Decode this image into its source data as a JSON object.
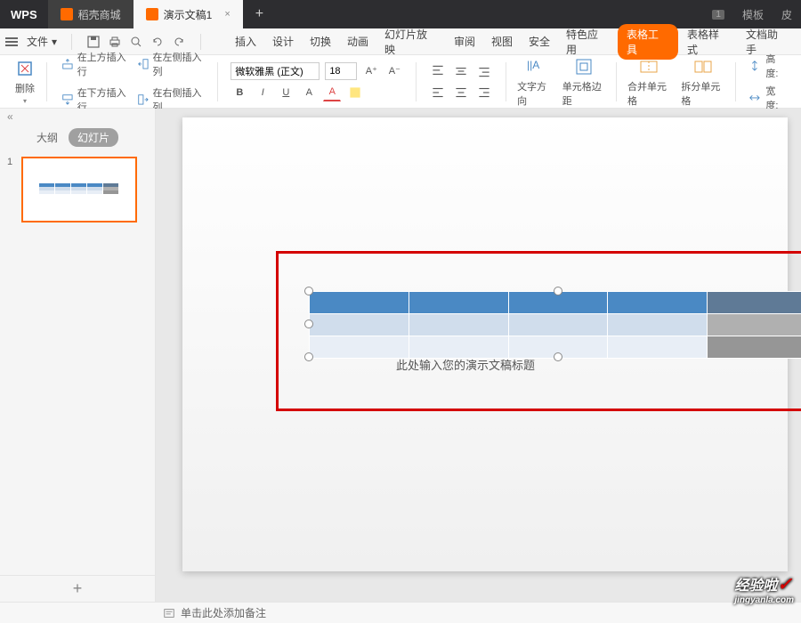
{
  "titlebar": {
    "logo": "WPS",
    "tabs": [
      {
        "label": "稻壳商城",
        "icon": "orange"
      },
      {
        "label": "演示文稿1",
        "icon": "orange",
        "active": true,
        "close": "×"
      }
    ],
    "add": "+",
    "right": {
      "badge": "1",
      "template": "模板",
      "skin": "皮"
    }
  },
  "menubar": {
    "file": "文件",
    "menus": [
      "插入",
      "设计",
      "切换",
      "动画",
      "幻灯片放映",
      "审阅",
      "视图",
      "安全",
      "特色应用"
    ],
    "active_tool": "表格工具",
    "extra": [
      "表格样式",
      "文档助手"
    ]
  },
  "ribbon": {
    "delete": "删除",
    "insert_above": "在上方插入行",
    "insert_below": "在下方插入行",
    "insert_left": "在左侧插入列",
    "insert_right": "在右侧插入列",
    "font_name": "微软雅黑 (正文)",
    "font_size": "18",
    "text_direction": "文字方向",
    "cell_margin": "单元格边距",
    "merge_cells": "合并单元格",
    "split_cells": "拆分单元格",
    "height": "高度:",
    "width": "宽度:"
  },
  "sidepanel": {
    "outline": "大纲",
    "slides": "幻灯片",
    "collapse": "«",
    "slide_num": "1",
    "add": "+"
  },
  "canvas": {
    "placeholder": "此处输入您的演示文稿标题"
  },
  "statusbar": {
    "notes": "单击此处添加备注"
  },
  "watermark": {
    "main": "经验啦",
    "sub": "jingyanla.com",
    "check": "✓"
  }
}
